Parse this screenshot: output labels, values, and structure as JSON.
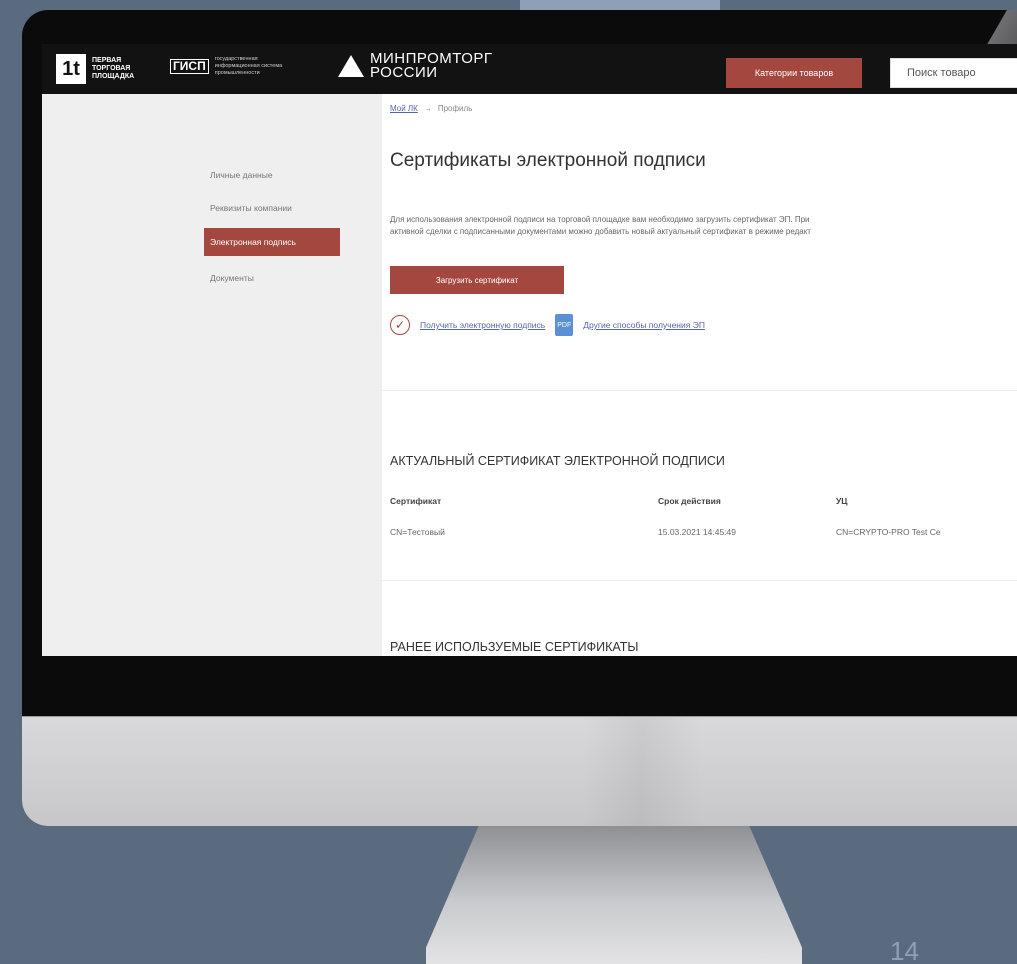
{
  "header": {
    "logo1_mark": "1t",
    "logo1_text": "ПЕРВАЯ ТОРГОВАЯ ПЛОЩАДКА",
    "logo2_mark": "ГИСП",
    "logo2_text": "государственная информационная система промышленности",
    "logo3_text": "МИНПРОМТОРГ РОССИИ",
    "categories_button": "Категории товаров",
    "search_value": "Поиск товаро"
  },
  "sidebar": {
    "items": [
      {
        "label": "Личные данные"
      },
      {
        "label": "Реквизиты компании"
      },
      {
        "label": "Электронная подпись"
      },
      {
        "label": "Документы"
      }
    ]
  },
  "breadcrumb": {
    "link": "Мой ЛК",
    "arrow": "→",
    "current": "Профиль"
  },
  "main": {
    "title": "Сертификаты электронной подписи",
    "desc_line1": "Для использования электронной подписи на торговой площадке вам необходимо загрузить сертификат ЭП. При",
    "desc_line2": "активной сделки с подписанными документами можно добавить новый актуальный сертификат в режиме редакт",
    "upload_button": "Загрузить сертификат",
    "link_get_signature": "Получить электронную подпись",
    "link_other_ways": "Другие способы получения ЭП",
    "doc_icon_label": "PDF"
  },
  "current_cert": {
    "heading": "АКТУАЛЬНЫЙ СЕРТИФИКАТ ЭЛЕКТРОННОЙ ПОДПИСИ",
    "columns": [
      "Сертификат",
      "Срок действия",
      "УЦ"
    ],
    "row": [
      "CN=Тестовый",
      "15.03.2021 14:45:49",
      "CN=CRYPTO-PRO Test Ce"
    ]
  },
  "previous_certs": {
    "heading": "РАНЕЕ ИСПОЛЬЗУЕМЫЕ СЕРТИФИКАТЫ"
  },
  "slide": {
    "page_number": "14"
  },
  "colors": {
    "accent": "#a3473f",
    "link": "#5566aa",
    "topbar": "#121212"
  }
}
